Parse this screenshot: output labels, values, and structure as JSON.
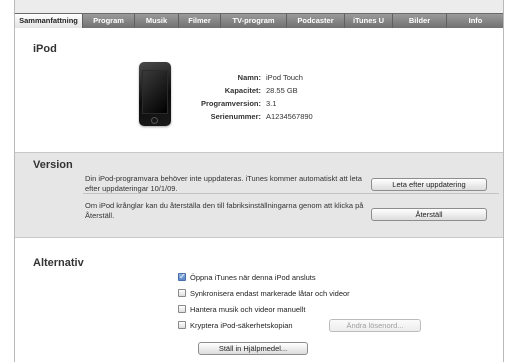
{
  "tabs": [
    {
      "label": "Sammanfattning",
      "active": true
    },
    {
      "label": "Program",
      "active": false
    },
    {
      "label": "Musik",
      "active": false
    },
    {
      "label": "Filmer",
      "active": false
    },
    {
      "label": "TV-program",
      "active": false
    },
    {
      "label": "Podcaster",
      "active": false
    },
    {
      "label": "iTunes U",
      "active": false
    },
    {
      "label": "Bilder",
      "active": false
    },
    {
      "label": "Info",
      "active": false
    }
  ],
  "ipod": {
    "title": "iPod",
    "fields": [
      {
        "label": "Namn:",
        "value": "iPod Touch"
      },
      {
        "label": "Kapacitet:",
        "value": "28.55 GB"
      },
      {
        "label": "Programversion:",
        "value": "3.1"
      },
      {
        "label": "Serienummer:",
        "value": "A1234567890"
      }
    ]
  },
  "version": {
    "title": "Version",
    "update_text": "Din iPod-programvara behöver inte uppdateras. iTunes kommer automatiskt att leta efter uppdateringar 10/1/09.",
    "update_button": "Leta efter uppdatering",
    "restore_text": "Om iPod krånglar kan du återställa den till fabriksinställningarna genom att klicka på Återställ.",
    "restore_button": "Återställ"
  },
  "alternativ": {
    "title": "Alternativ",
    "options": [
      {
        "label": "Öppna iTunes när denna iPod ansluts",
        "checked": true
      },
      {
        "label": "Synkronisera endast markerade låtar och videor",
        "checked": false
      },
      {
        "label": "Hantera musik och videor manuellt",
        "checked": false
      },
      {
        "label": "Kryptera iPod-säkerhetskopian",
        "checked": false
      }
    ],
    "change_password_button": "Ändra lösenord...",
    "accessibility_button": "Ställ in Hjälpmedel..."
  }
}
